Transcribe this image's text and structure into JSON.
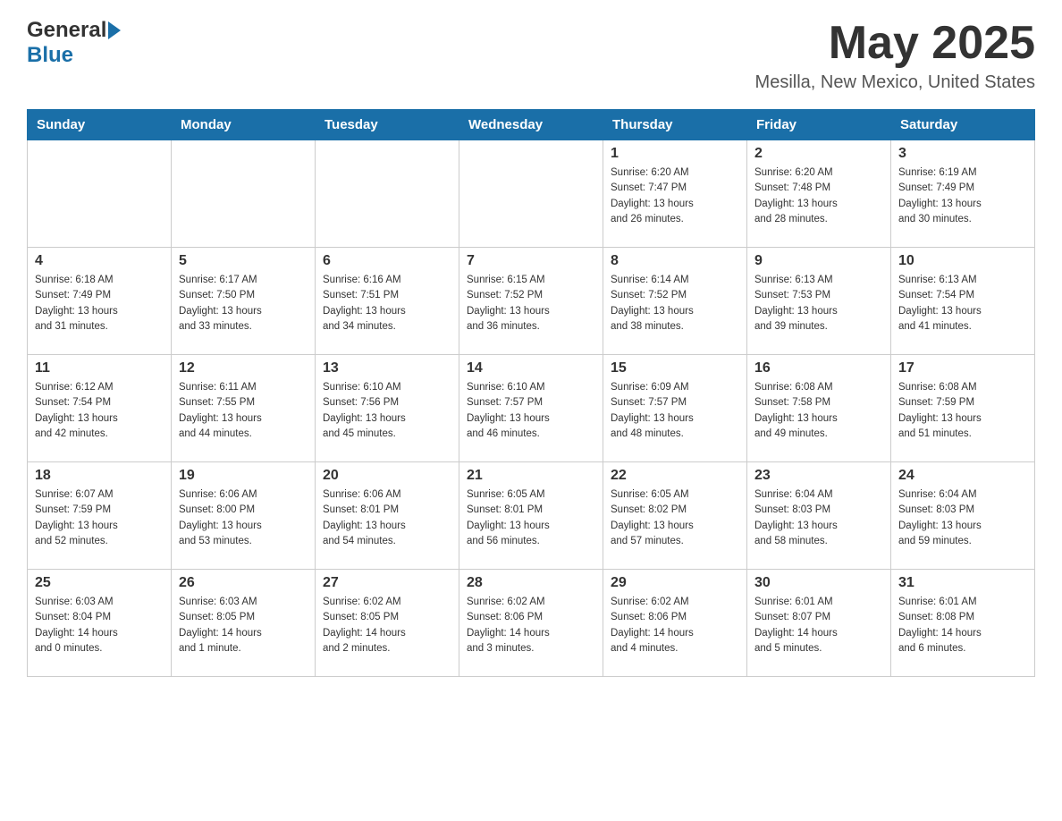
{
  "header": {
    "logo_general": "General",
    "logo_blue": "Blue",
    "month_title": "May 2025",
    "location": "Mesilla, New Mexico, United States"
  },
  "days_of_week": [
    "Sunday",
    "Monday",
    "Tuesday",
    "Wednesday",
    "Thursday",
    "Friday",
    "Saturday"
  ],
  "weeks": [
    [
      {
        "day": "",
        "info": ""
      },
      {
        "day": "",
        "info": ""
      },
      {
        "day": "",
        "info": ""
      },
      {
        "day": "",
        "info": ""
      },
      {
        "day": "1",
        "info": "Sunrise: 6:20 AM\nSunset: 7:47 PM\nDaylight: 13 hours\nand 26 minutes."
      },
      {
        "day": "2",
        "info": "Sunrise: 6:20 AM\nSunset: 7:48 PM\nDaylight: 13 hours\nand 28 minutes."
      },
      {
        "day": "3",
        "info": "Sunrise: 6:19 AM\nSunset: 7:49 PM\nDaylight: 13 hours\nand 30 minutes."
      }
    ],
    [
      {
        "day": "4",
        "info": "Sunrise: 6:18 AM\nSunset: 7:49 PM\nDaylight: 13 hours\nand 31 minutes."
      },
      {
        "day": "5",
        "info": "Sunrise: 6:17 AM\nSunset: 7:50 PM\nDaylight: 13 hours\nand 33 minutes."
      },
      {
        "day": "6",
        "info": "Sunrise: 6:16 AM\nSunset: 7:51 PM\nDaylight: 13 hours\nand 34 minutes."
      },
      {
        "day": "7",
        "info": "Sunrise: 6:15 AM\nSunset: 7:52 PM\nDaylight: 13 hours\nand 36 minutes."
      },
      {
        "day": "8",
        "info": "Sunrise: 6:14 AM\nSunset: 7:52 PM\nDaylight: 13 hours\nand 38 minutes."
      },
      {
        "day": "9",
        "info": "Sunrise: 6:13 AM\nSunset: 7:53 PM\nDaylight: 13 hours\nand 39 minutes."
      },
      {
        "day": "10",
        "info": "Sunrise: 6:13 AM\nSunset: 7:54 PM\nDaylight: 13 hours\nand 41 minutes."
      }
    ],
    [
      {
        "day": "11",
        "info": "Sunrise: 6:12 AM\nSunset: 7:54 PM\nDaylight: 13 hours\nand 42 minutes."
      },
      {
        "day": "12",
        "info": "Sunrise: 6:11 AM\nSunset: 7:55 PM\nDaylight: 13 hours\nand 44 minutes."
      },
      {
        "day": "13",
        "info": "Sunrise: 6:10 AM\nSunset: 7:56 PM\nDaylight: 13 hours\nand 45 minutes."
      },
      {
        "day": "14",
        "info": "Sunrise: 6:10 AM\nSunset: 7:57 PM\nDaylight: 13 hours\nand 46 minutes."
      },
      {
        "day": "15",
        "info": "Sunrise: 6:09 AM\nSunset: 7:57 PM\nDaylight: 13 hours\nand 48 minutes."
      },
      {
        "day": "16",
        "info": "Sunrise: 6:08 AM\nSunset: 7:58 PM\nDaylight: 13 hours\nand 49 minutes."
      },
      {
        "day": "17",
        "info": "Sunrise: 6:08 AM\nSunset: 7:59 PM\nDaylight: 13 hours\nand 51 minutes."
      }
    ],
    [
      {
        "day": "18",
        "info": "Sunrise: 6:07 AM\nSunset: 7:59 PM\nDaylight: 13 hours\nand 52 minutes."
      },
      {
        "day": "19",
        "info": "Sunrise: 6:06 AM\nSunset: 8:00 PM\nDaylight: 13 hours\nand 53 minutes."
      },
      {
        "day": "20",
        "info": "Sunrise: 6:06 AM\nSunset: 8:01 PM\nDaylight: 13 hours\nand 54 minutes."
      },
      {
        "day": "21",
        "info": "Sunrise: 6:05 AM\nSunset: 8:01 PM\nDaylight: 13 hours\nand 56 minutes."
      },
      {
        "day": "22",
        "info": "Sunrise: 6:05 AM\nSunset: 8:02 PM\nDaylight: 13 hours\nand 57 minutes."
      },
      {
        "day": "23",
        "info": "Sunrise: 6:04 AM\nSunset: 8:03 PM\nDaylight: 13 hours\nand 58 minutes."
      },
      {
        "day": "24",
        "info": "Sunrise: 6:04 AM\nSunset: 8:03 PM\nDaylight: 13 hours\nand 59 minutes."
      }
    ],
    [
      {
        "day": "25",
        "info": "Sunrise: 6:03 AM\nSunset: 8:04 PM\nDaylight: 14 hours\nand 0 minutes."
      },
      {
        "day": "26",
        "info": "Sunrise: 6:03 AM\nSunset: 8:05 PM\nDaylight: 14 hours\nand 1 minute."
      },
      {
        "day": "27",
        "info": "Sunrise: 6:02 AM\nSunset: 8:05 PM\nDaylight: 14 hours\nand 2 minutes."
      },
      {
        "day": "28",
        "info": "Sunrise: 6:02 AM\nSunset: 8:06 PM\nDaylight: 14 hours\nand 3 minutes."
      },
      {
        "day": "29",
        "info": "Sunrise: 6:02 AM\nSunset: 8:06 PM\nDaylight: 14 hours\nand 4 minutes."
      },
      {
        "day": "30",
        "info": "Sunrise: 6:01 AM\nSunset: 8:07 PM\nDaylight: 14 hours\nand 5 minutes."
      },
      {
        "day": "31",
        "info": "Sunrise: 6:01 AM\nSunset: 8:08 PM\nDaylight: 14 hours\nand 6 minutes."
      }
    ]
  ],
  "accent_color": "#1a6fa8"
}
